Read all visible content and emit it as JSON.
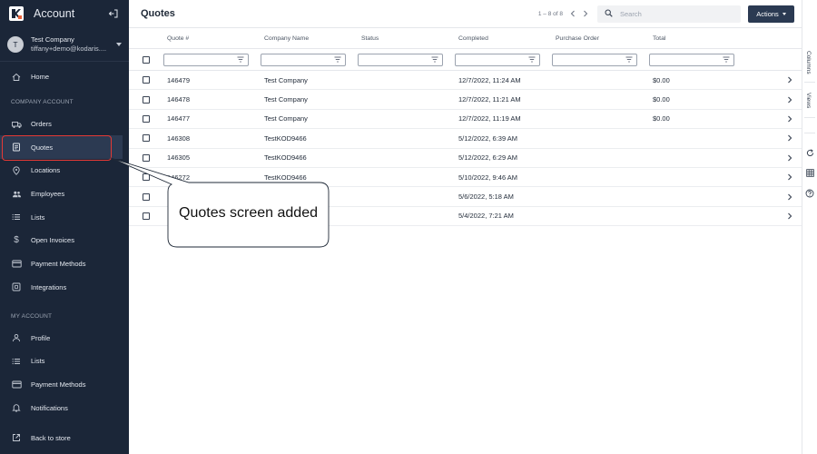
{
  "sidebar": {
    "app_title": "Account",
    "user": {
      "avatar_initial": "T",
      "company": "Test Company",
      "email": "tiffany+demo@kodaris...."
    },
    "nav_top": [
      {
        "label": "Home",
        "icon": "home-icon"
      }
    ],
    "company_section_label": "COMPANY ACCOUNT",
    "company_items": [
      {
        "label": "Orders",
        "icon": "truck-icon"
      },
      {
        "label": "Quotes",
        "icon": "clipboard-icon",
        "active": true
      },
      {
        "label": "Locations",
        "icon": "map-pin-icon"
      },
      {
        "label": "Employees",
        "icon": "users-icon"
      },
      {
        "label": "Lists",
        "icon": "list-icon"
      },
      {
        "label": "Open Invoices",
        "icon": "dollar-icon"
      },
      {
        "label": "Payment Methods",
        "icon": "credit-card-icon"
      },
      {
        "label": "Integrations",
        "icon": "plug-icon"
      }
    ],
    "my_section_label": "MY ACCOUNT",
    "my_items": [
      {
        "label": "Profile",
        "icon": "person-icon"
      },
      {
        "label": "Lists",
        "icon": "list-icon"
      },
      {
        "label": "Payment Methods",
        "icon": "credit-card-icon"
      },
      {
        "label": "Notifications",
        "icon": "bell-icon"
      }
    ],
    "back_label": "Back to store"
  },
  "header": {
    "title": "Quotes",
    "pagination": "1 – 8 of 8",
    "search_placeholder": "Search",
    "actions_label": "Actions"
  },
  "table": {
    "columns": [
      "Quote #",
      "Company Name",
      "Status",
      "Completed",
      "Purchase Order",
      "Total"
    ],
    "rows": [
      {
        "quote": "146479",
        "company": "Test Company",
        "status": "",
        "completed": "12/7/2022, 11:24 AM",
        "po": "",
        "total": "$0.00"
      },
      {
        "quote": "146478",
        "company": "Test Company",
        "status": "",
        "completed": "12/7/2022, 11:21 AM",
        "po": "",
        "total": "$0.00"
      },
      {
        "quote": "146477",
        "company": "Test Company",
        "status": "",
        "completed": "12/7/2022, 11:19 AM",
        "po": "",
        "total": "$0.00"
      },
      {
        "quote": "146308",
        "company": "TestKOD9466",
        "status": "",
        "completed": "5/12/2022, 6:39 AM",
        "po": "",
        "total": ""
      },
      {
        "quote": "146305",
        "company": "TestKOD9466",
        "status": "",
        "completed": "5/12/2022, 6:29 AM",
        "po": "",
        "total": ""
      },
      {
        "quote": "146272",
        "company": "TestKOD9466",
        "status": "",
        "completed": "5/10/2022, 9:46 AM",
        "po": "",
        "total": ""
      },
      {
        "quote": "",
        "company": "",
        "status": "",
        "completed": "5/6/2022, 5:18 AM",
        "po": "",
        "total": ""
      },
      {
        "quote": "",
        "company": "",
        "status": "",
        "completed": "5/4/2022, 7:21 AM",
        "po": "",
        "total": ""
      }
    ]
  },
  "right_rail": {
    "columns_tab": "Columns",
    "views_tab": "Views"
  },
  "annotation": {
    "text": "Quotes screen added",
    "highlight_color": "#e53935"
  },
  "colors": {
    "sidebar_bg": "#1b2638",
    "active_item_bg": "#2c3a52",
    "actions_button_bg": "#2b3a52"
  }
}
